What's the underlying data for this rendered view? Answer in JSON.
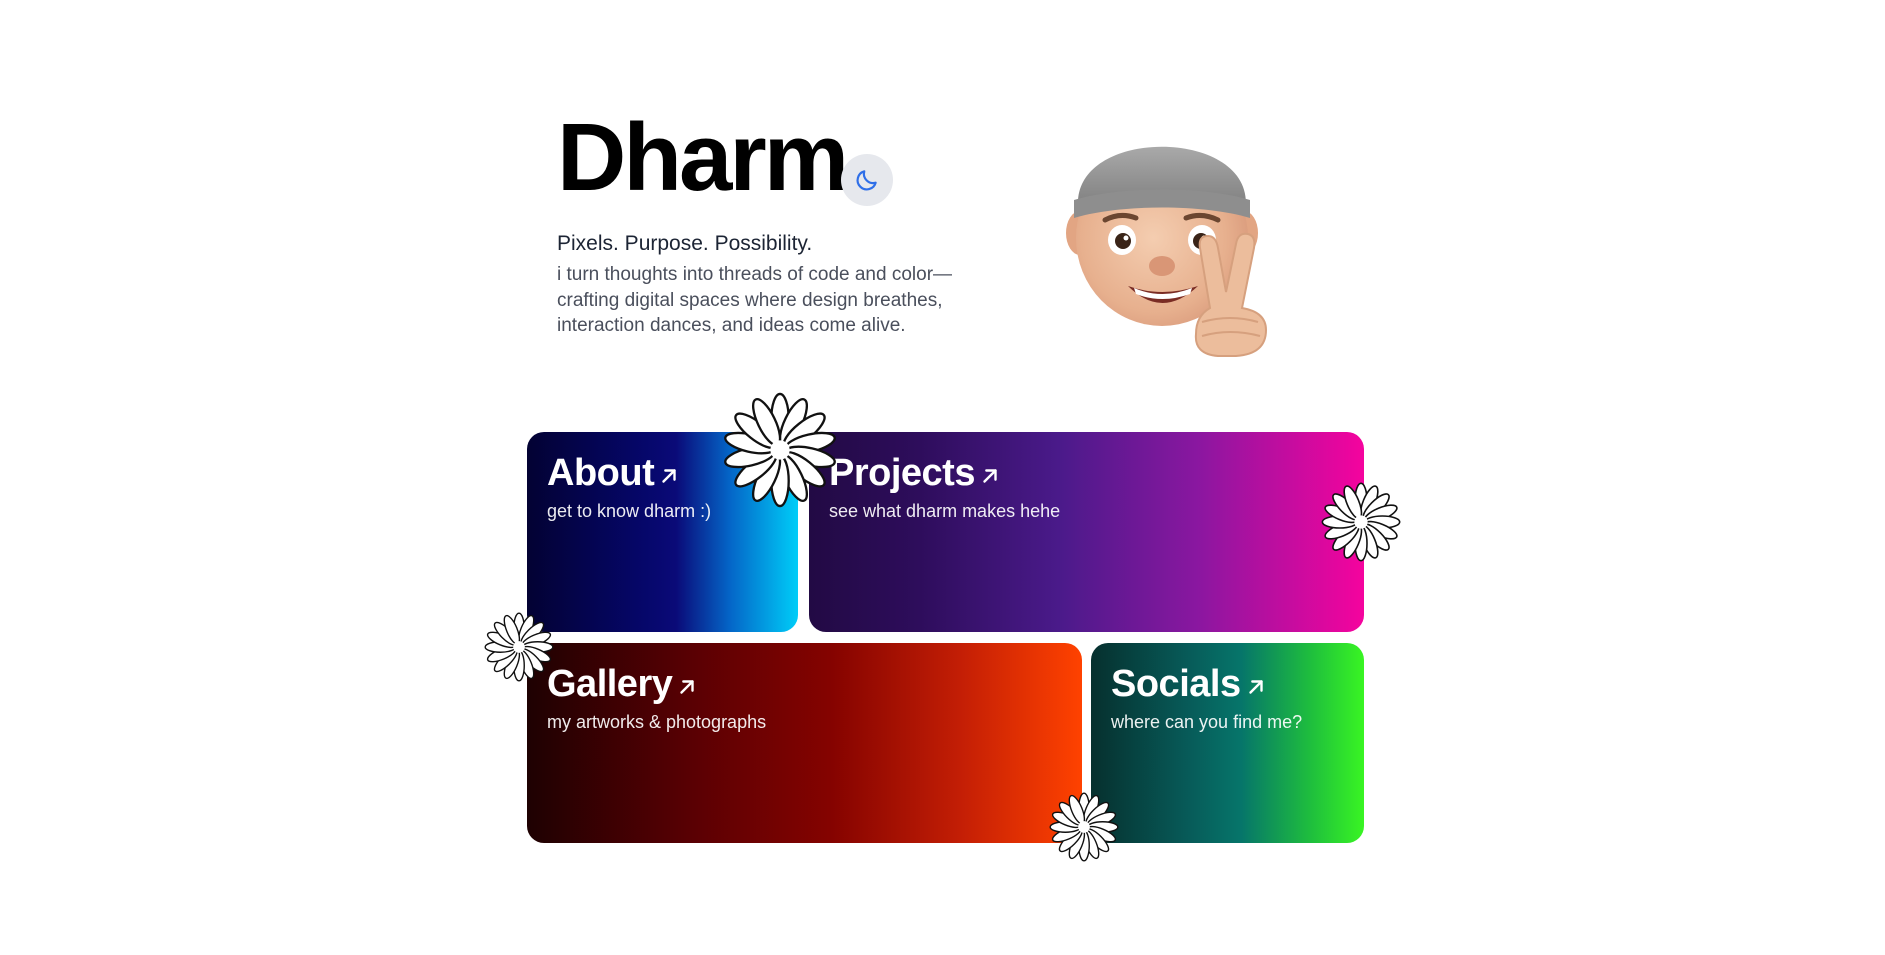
{
  "header": {
    "name": "Dharm",
    "tagline": "Pixels. Purpose. Possibility.",
    "bio": "i turn thoughts into threads of code and color—crafting digital spaces where design breathes, interaction dances, and ideas come alive."
  },
  "theme_toggle": {
    "icon": "moon-icon",
    "color": "#2f6fe8"
  },
  "avatar": {
    "icon": "memoji-peace-sign"
  },
  "cards": {
    "about": {
      "title": "About",
      "subtitle": "get to know dharm :)",
      "icon": "arrow-up-right-icon"
    },
    "projects": {
      "title": "Projects",
      "subtitle": "see what dharm makes hehe",
      "icon": "arrow-up-right-icon"
    },
    "gallery": {
      "title": "Gallery",
      "subtitle": "my artworks & photographs",
      "icon": "arrow-up-right-icon"
    },
    "socials": {
      "title": "Socials",
      "subtitle": "where can you find me?",
      "icon": "arrow-up-right-icon"
    }
  },
  "decorations": {
    "icon": "daisy-flower-icon"
  }
}
